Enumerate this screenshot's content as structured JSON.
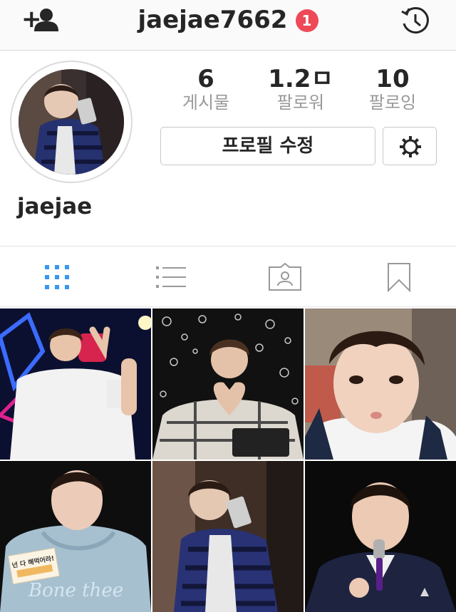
{
  "header": {
    "username": "jaejae7662",
    "notification_count": "1"
  },
  "profile": {
    "display_name": "jaejae",
    "edit_button_label": "프로필 수정",
    "stats": [
      {
        "value": "6",
        "label": "게시물"
      },
      {
        "value": "1.2ㅁ",
        "label": "팔로워"
      },
      {
        "value": "10",
        "label": "팔로잉"
      }
    ]
  },
  "icons": {
    "add_user": "add-user-icon",
    "history": "history-icon",
    "settings": "gear-icon",
    "grid_view": "grid-icon",
    "list_view": "list-icon",
    "tagged": "tagged-icon",
    "saved": "bookmark-icon"
  },
  "tabs": [
    "grid",
    "list",
    "tagged",
    "saved"
  ],
  "posts": [
    {
      "id": "post-1",
      "image_text": ""
    },
    {
      "id": "post-2",
      "image_text": ""
    },
    {
      "id": "post-3",
      "image_text": ""
    },
    {
      "id": "post-4",
      "image_text": "넌 다 해먹어라!"
    },
    {
      "id": "post-5",
      "image_text": ""
    },
    {
      "id": "post-6",
      "image_text": ""
    }
  ],
  "colors": {
    "badge": "#ed4956",
    "active_tab": "#3897f0",
    "inactive_tab": "#999999",
    "muted_text": "#999999"
  }
}
